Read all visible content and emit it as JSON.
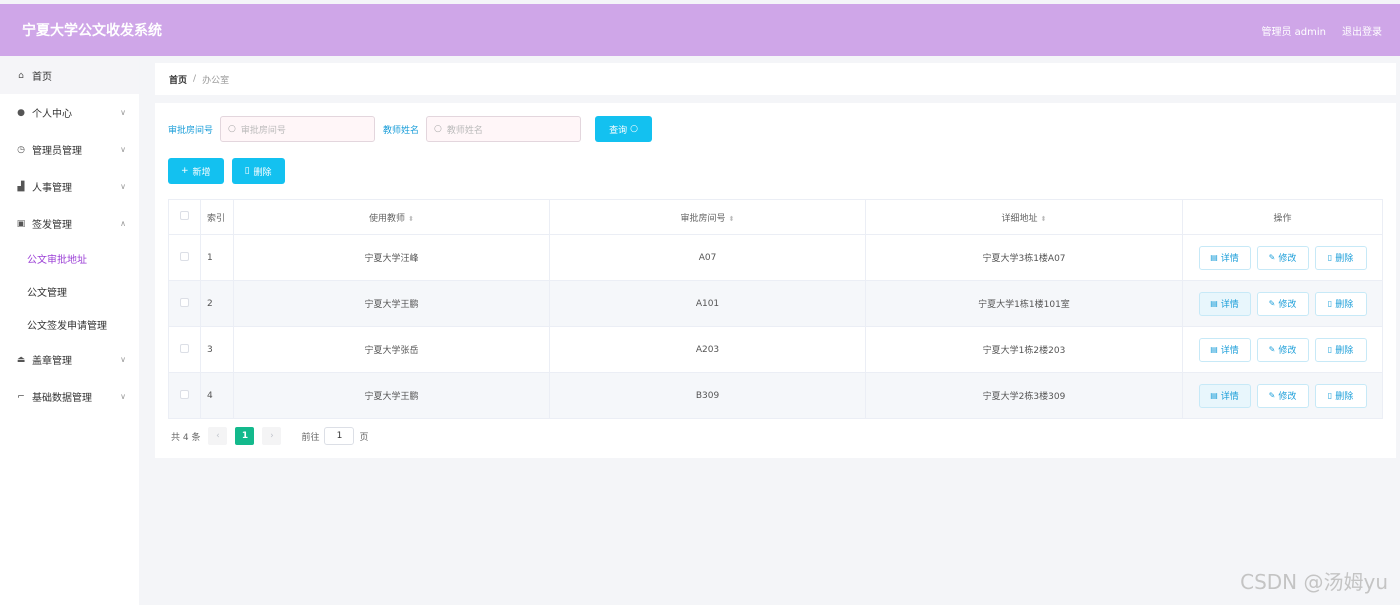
{
  "header": {
    "title": "宁夏大学公文收发系统",
    "user": "管理员 admin",
    "logout": "退出登录"
  },
  "sidebar": {
    "items": [
      {
        "label": "首页",
        "icon": "home-icon"
      },
      {
        "label": "个人中心",
        "icon": "user-icon"
      },
      {
        "label": "管理员管理",
        "icon": "compass-icon"
      },
      {
        "label": "人事管理",
        "icon": "chart-icon"
      },
      {
        "label": "签发管理",
        "icon": "document-icon"
      },
      {
        "label": "盖章管理",
        "icon": "stamp-icon"
      },
      {
        "label": "基础数据管理",
        "icon": "crop-icon"
      }
    ],
    "sub_items": [
      "公文审批地址",
      "公文管理",
      "公文签发申请管理"
    ]
  },
  "breadcrumb": {
    "home": "首页",
    "separator": "/",
    "current": "办公室"
  },
  "search": {
    "room_label": "审批房间号",
    "room_placeholder": "审批房间号",
    "teacher_label": "教师姓名",
    "teacher_placeholder": "教师姓名",
    "query_label": "查询"
  },
  "actions": {
    "add_label": "新增",
    "delete_label": "删除"
  },
  "table": {
    "headers": {
      "index": "索引",
      "teacher": "使用教师",
      "room": "审批房间号",
      "address": "详细地址",
      "ops": "操作"
    },
    "rows": [
      {
        "index": "1",
        "teacher": "宁夏大学汪峰",
        "room": "A07",
        "address": "宁夏大学3栋1楼A07"
      },
      {
        "index": "2",
        "teacher": "宁夏大学王鹏",
        "room": "A101",
        "address": "宁夏大学1栋1楼101室"
      },
      {
        "index": "3",
        "teacher": "宁夏大学张岳",
        "room": "A203",
        "address": "宁夏大学1栋2楼203"
      },
      {
        "index": "4",
        "teacher": "宁夏大学王鹏",
        "room": "B309",
        "address": "宁夏大学2栋3楼309"
      }
    ],
    "op_labels": {
      "detail": "详情",
      "edit": "修改",
      "delete": "删除"
    }
  },
  "pager": {
    "total": "共 4 条",
    "page": "1",
    "goto_label": "前往",
    "goto_value": "1",
    "page_unit": "页"
  },
  "watermark": "CSDN @汤姆yu",
  "colors": {
    "header": "#cfa6e8",
    "accent": "#13c1f0",
    "pager_active": "#13b98c",
    "sub_current": "#9b3fd6"
  }
}
